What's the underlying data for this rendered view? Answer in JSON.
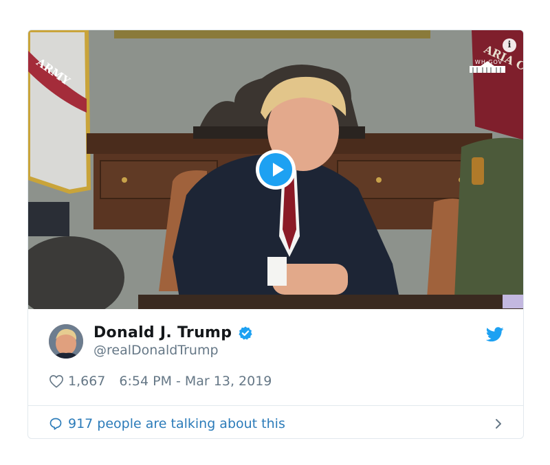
{
  "tweet": {
    "author": {
      "display_name": "Donald J. Trump",
      "handle": "@realDonaldTrump",
      "verified": true
    },
    "likes": "1,667",
    "timestamp": "6:54 PM - Mar 13, 2019",
    "talking": "917 people are talking about this"
  },
  "media": {
    "info_icon": "i",
    "logo_text": "WH.GOV",
    "flag_left_text": "ARMY",
    "flag_right_text": "ARIA COR"
  },
  "colors": {
    "accent": "#1da1f2",
    "link": "#2b7bb9",
    "muted": "#657786",
    "text": "#14171a"
  }
}
